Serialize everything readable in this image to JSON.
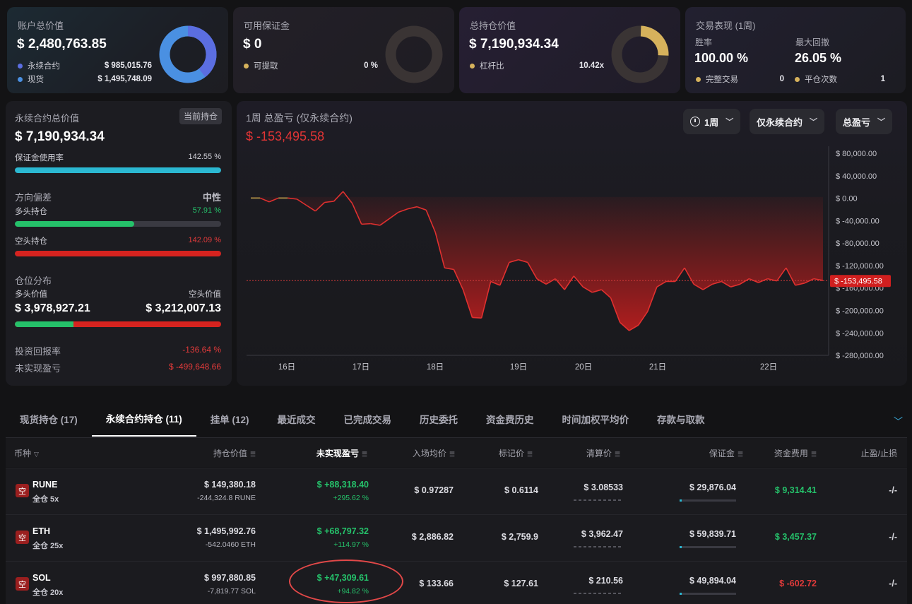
{
  "cards": {
    "account": {
      "title": "账户总价值",
      "value": "$ 2,480,763.85",
      "rows": [
        {
          "label": "永续合约",
          "value": "$ 985,015.76",
          "color": "#5b6ee1"
        },
        {
          "label": "现货",
          "value": "$ 1,495,748.09",
          "color": "#4a90e2"
        }
      ]
    },
    "margin": {
      "title": "可用保证金",
      "value": "$ 0",
      "rows": [
        {
          "label": "可提取",
          "value": "0 %",
          "color": "#d6b25c"
        }
      ]
    },
    "position": {
      "title": "总持仓价值",
      "value": "$ 7,190,934.34",
      "rows": [
        {
          "label": "杠杆比",
          "value": "10.42x",
          "color": "#d6b25c"
        }
      ]
    },
    "performance": {
      "title": "交易表现 (1周)",
      "win_rate_label": "胜率",
      "win_rate": "100.00 %",
      "drawdown_label": "最大回撤",
      "drawdown": "26.05 %",
      "trades_label": "完整交易",
      "trades": "0",
      "closes_label": "平仓次数",
      "closes": "1"
    }
  },
  "perp": {
    "title": "永续合约总价值",
    "tag": "当前持仓",
    "value": "$ 7,190,934.34",
    "margin_usage_label": "保证金使用率",
    "margin_usage": "142.55 %",
    "bias_label": "方向偏差",
    "bias_value": "中性",
    "long_label": "多头持仓",
    "long_pct": "57.91 %",
    "short_label": "空头持仓",
    "short_pct": "142.09 %",
    "dist_label": "仓位分布",
    "long_value_label": "多头价值",
    "short_value_label": "空头价值",
    "long_value": "$ 3,978,927.21",
    "short_value": "$ 3,212,007.13",
    "roi_label": "投资回报率",
    "roi": "-136.64 %",
    "upnl_label": "未实现盈亏",
    "upnl": "$ -499,648.66"
  },
  "chart_panel": {
    "title": "1周 总盈亏 (仅永续合约)",
    "pnl": "$ -153,495.58",
    "dropdowns": {
      "period": "1周",
      "scope": "仅永续合约",
      "metric": "总盈亏"
    }
  },
  "chart_data": {
    "type": "area",
    "title": "1周 总盈亏 (仅永续合约)",
    "x_ticks": [
      "16日",
      "17日",
      "18日",
      "19日",
      "20日",
      "21日",
      "22日"
    ],
    "y_ticks": [
      "$ 80,000.00",
      "$ 40,000.00",
      "$ 0.00",
      "$ -40,000.00",
      "$ -80,000.00",
      "$ -120,000.00",
      "$ -160,000.00",
      "$ -200,000.00",
      "$ -240,000.00",
      "$ -280,000.00"
    ],
    "ylim": [
      -280000,
      80000
    ],
    "current_label": "$ -153,495.58",
    "current_value": -153495.58,
    "series": [
      {
        "values": [
          -2000,
          -2000,
          -9000,
          -2000,
          -2000,
          -4000,
          -15000,
          -26000,
          -10000,
          -8000,
          10000,
          -12000,
          -50000,
          -49000,
          -52000,
          -40000,
          -28000,
          -22000,
          -18000,
          -24000,
          -65000,
          -130000,
          -133000,
          -170000,
          -221000,
          -222000,
          -155000,
          -162000,
          -120000,
          -115000,
          -120000,
          -150000,
          -160000,
          -150000,
          -170000,
          -145000,
          -165000,
          -175000,
          -170000,
          -185000,
          -230000,
          -245000,
          -235000,
          -210000,
          -165000,
          -155000,
          -155000,
          -130000,
          -160000,
          -170000,
          -160000,
          -155000,
          -165000,
          -160000,
          -150000,
          -157000,
          -150000,
          -154000,
          -130000,
          -162000,
          -158000,
          -150000,
          -153000
        ]
      }
    ]
  },
  "tabs": [
    "现货持仓 (17)",
    "永续合约持仓 (11)",
    "挂单 (12)",
    "最近成交",
    "已完成交易",
    "历史委托",
    "资金费历史",
    "时间加权平均价",
    "存款与取款"
  ],
  "table": {
    "headers": [
      "币种",
      "持仓价值",
      "未实现盈亏",
      "入场均价",
      "标记价",
      "清算价",
      "保证金",
      "资金费用",
      "止盈/止损"
    ],
    "rows": [
      {
        "side": "空",
        "symbol": "RUNE",
        "mode": "全仓 5x",
        "value": "$ 149,380.18",
        "qty": "-244,324.8 RUNE",
        "upnl": "$ +88,318.40",
        "upnl_pct": "+295.62 %",
        "entry": "$ 0.97287",
        "mark": "$ 0.6114",
        "liq": "$ 3.08533",
        "margin": "$ 29,876.04",
        "funding": "$ 9,314.41",
        "tpsl": "-/-"
      },
      {
        "side": "空",
        "symbol": "ETH",
        "mode": "全仓 25x",
        "value": "$ 1,495,992.76",
        "qty": "-542.0460 ETH",
        "upnl": "$ +68,797.32",
        "upnl_pct": "+114.97 %",
        "entry": "$ 2,886.82",
        "mark": "$ 2,759.9",
        "liq": "$ 3,962.47",
        "margin": "$ 59,839.71",
        "funding": "$ 3,457.37",
        "tpsl": "-/-"
      },
      {
        "side": "空",
        "symbol": "SOL",
        "mode": "全仓 20x",
        "value": "$ 997,880.85",
        "qty": "-7,819.77 SOL",
        "upnl": "$ +47,309.61",
        "upnl_pct": "+94.82 %",
        "entry": "$ 133.66",
        "mark": "$ 127.61",
        "liq": "$ 210.56",
        "margin": "$ 49,894.04",
        "funding": "$ -602.72",
        "tpsl": "-/-"
      }
    ]
  },
  "colors": {
    "green": "#25c16a",
    "red": "#e03a3a",
    "cyan": "#2bb8d2"
  }
}
